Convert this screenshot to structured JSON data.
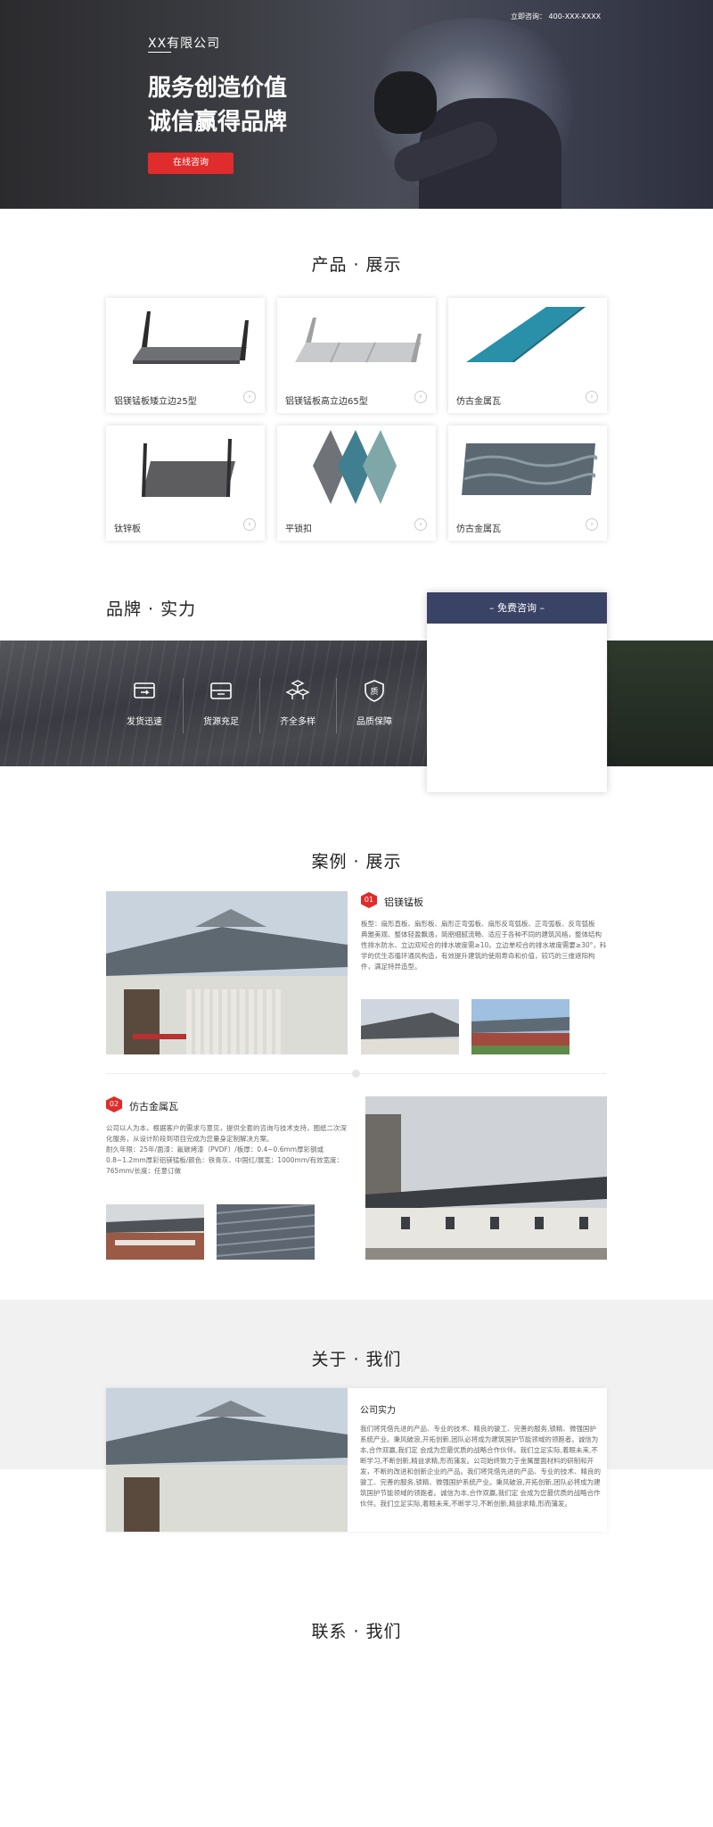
{
  "hero": {
    "company": "XX有限公司",
    "slogan_line1": "服务创造价值",
    "slogan_line2": "诚信赢得品牌",
    "hotline": "立即咨询：  400-XXX-XXXX",
    "button_label": "在线咨询"
  },
  "products": {
    "title": "产品 · 展示",
    "items": [
      {
        "label": "铝镁锰板矮立边25型"
      },
      {
        "label": "铝镁锰板高立边65型"
      },
      {
        "label": "仿古金属瓦"
      },
      {
        "label": "钛锌板"
      },
      {
        "label": "平锁扣"
      },
      {
        "label": "仿古金属瓦"
      }
    ]
  },
  "brand": {
    "title": "品牌 · 实力",
    "features": [
      {
        "label": "发货迅速",
        "icon": "truck-icon"
      },
      {
        "label": "货源充足",
        "icon": "box-icon"
      },
      {
        "label": "齐全多样",
        "icon": "cubes-icon"
      },
      {
        "label": "品质保障",
        "icon": "shield-quality-icon"
      }
    ],
    "consult_title": "– 免费咨询 –"
  },
  "cases": {
    "title": "案例 · 展示",
    "items": [
      {
        "num": "01",
        "name": "铝镁锰板",
        "desc": "板型：扇形直板、扇形板、扇形正弯弧板、扇形反弯弧板、正弯弧板、反弯弧板\n典雅美观、整体轻盈飘逸，简朋细腻流畅、适应于各种不同的建筑风格，整体结构性排水防水、立边双咬合的排水坡度需≥10。立边单咬合的排水坡度需要≥30°，科学的优生态循环通风构造，有效提升建筑的使用寿命和价值，较巧的三维遮阳构件，满足特异造型。"
      },
      {
        "num": "02",
        "name": "仿古金属瓦",
        "desc": "公司以人为本，根据客户的需求与意见，提供全套的咨询与技术支持，图纸二次深化服务，从设计阶段到项目完成为您量身定制解决方案。\n耐久年限：25年/面漆：氟碳烤漆（PVDF）/板厚：0.4~0.6mm厚彩钢或0.8~1.2mm厚彩铝镁锰板/颜色：铁青灰、中国红/展宽：1000mm/有效宽度：765mm/长度：任意订做"
      }
    ]
  },
  "about": {
    "title": "关于 · 我们",
    "heading": "公司实力",
    "text": "我们将凭借先进的产品、专业的技术、精良的骏工、完善的服务,锁精、微强国护系统产业。秉风破浪,开拓创新,团队必将成为建筑国护节能领域的领跑者。诚信为本,合作双赢,我们定 会成为您最优质的战略合作伙伴。我们立足实际,着眼未来,不断学习,不断创新,精益求精,形而蒲发。公司始终致力于金属屋面材料的研制和开发，不断的改进和创新企业的产品。我们将凭借先进的产品、专业的技术、精良的骏工、完善的服务,锁精、微强国护系统产业。秉风破浪,开拓创新,团队必将成为建筑国护节能领域的领跑者。诚信为本,合作双赢,我们定 会成为您最优质的战略合作伙伴。我们立足实际,着眼未来,不断学习,不断创新,精益求精,形而蒲发。"
  },
  "contact": {
    "title": "联系 · 我们"
  },
  "colors": {
    "accent": "#e02c2c",
    "consult_header": "#3a4366",
    "about_bg": "#f1f1f1"
  }
}
